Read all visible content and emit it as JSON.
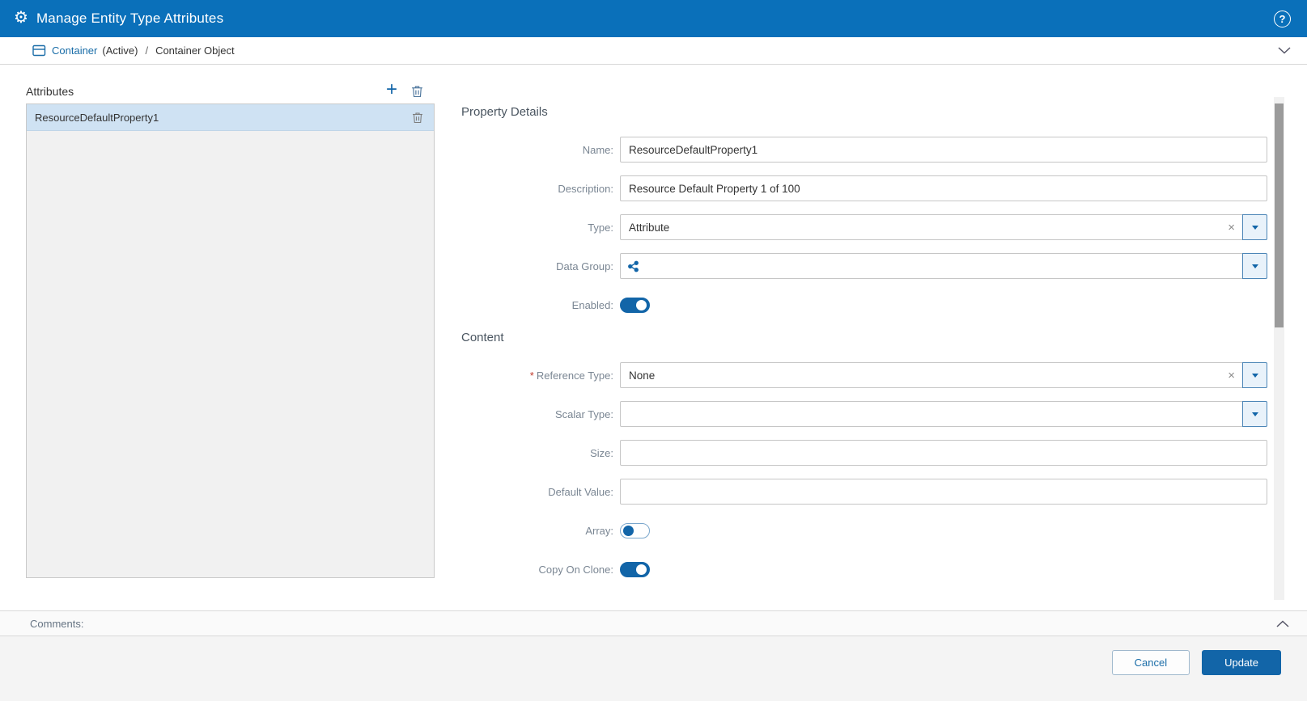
{
  "icons": {
    "gear": "⚙",
    "help": "?",
    "plus": "+",
    "clear": "×"
  },
  "titlebar": {
    "title": "Manage Entity Type Attributes"
  },
  "breadcrumb": {
    "entity": "Container",
    "status": "(Active)",
    "separator": "/",
    "current": "Container Object"
  },
  "attributes_panel": {
    "title": "Attributes",
    "items": [
      {
        "name": "ResourceDefaultProperty1"
      }
    ]
  },
  "form": {
    "property_details": {
      "heading": "Property Details",
      "name": {
        "label": "Name:",
        "value": "ResourceDefaultProperty1"
      },
      "description": {
        "label": "Description:",
        "value": "Resource Default Property 1 of 100"
      },
      "type": {
        "label": "Type:",
        "value": "Attribute"
      },
      "data_group": {
        "label": "Data Group:",
        "value": ""
      },
      "enabled": {
        "label": "Enabled:",
        "on": true
      }
    },
    "content": {
      "heading": "Content",
      "reference_type": {
        "required_mark": "*",
        "label": "Reference Type:",
        "value": "None"
      },
      "scalar_type": {
        "label": "Scalar Type:",
        "value": ""
      },
      "size": {
        "label": "Size:",
        "value": ""
      },
      "default_value": {
        "label": "Default Value:",
        "value": ""
      },
      "array": {
        "label": "Array:",
        "on": false
      },
      "copy_on_clone": {
        "label": "Copy On Clone:",
        "on": true
      }
    }
  },
  "comments": {
    "label": "Comments:"
  },
  "footer": {
    "cancel": "Cancel",
    "update": "Update"
  },
  "colors": {
    "header_bg": "#0a70ba",
    "accent": "#1265a8",
    "link": "#1a6da8",
    "selected_row": "#cfe2f3",
    "required": "#c0392b"
  }
}
